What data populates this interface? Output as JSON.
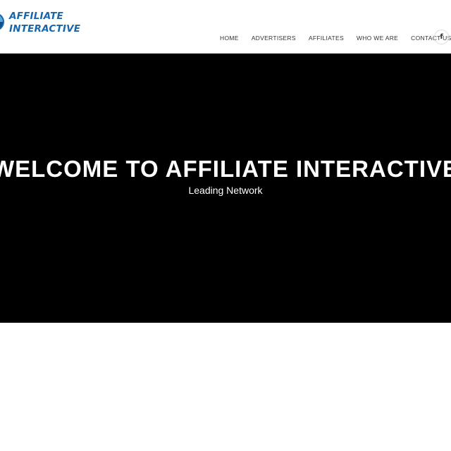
{
  "header": {
    "logo": {
      "line1": "AFFILIATE",
      "line2": "INTERACTIVE",
      "color": "#1a66a8"
    },
    "nav": [
      {
        "label": "HOME"
      },
      {
        "label": "ADVERTISERS"
      },
      {
        "label": "AFFILIATES"
      },
      {
        "label": "WHO WE ARE"
      },
      {
        "label": "CONTACT US"
      }
    ],
    "social": {
      "icon": "facebook-icon",
      "glyph": "f"
    }
  },
  "hero": {
    "title": "WELCOME TO AFFILIATE INTERACTIVE",
    "subtitle": "Leading Network",
    "background": "#000000"
  }
}
